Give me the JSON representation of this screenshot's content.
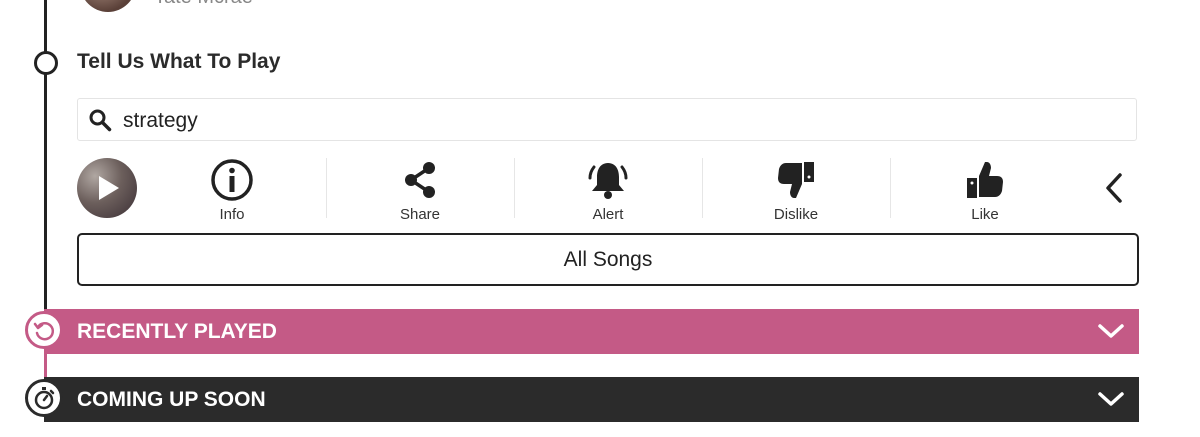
{
  "previous_item": {
    "title": "Tate Mcrae"
  },
  "section": {
    "title": "Tell Us What To Play"
  },
  "search": {
    "value": "strategy",
    "icon": "search-icon"
  },
  "actions": [
    {
      "label": "Info",
      "icon": "info-icon"
    },
    {
      "label": "Share",
      "icon": "share-icon"
    },
    {
      "label": "Alert",
      "icon": "bell-icon"
    },
    {
      "label": "Dislike",
      "icon": "thumbs-down-icon"
    },
    {
      "label": "Like",
      "icon": "thumbs-up-icon"
    }
  ],
  "all_songs": {
    "label": "All Songs"
  },
  "recently_played": {
    "label": "RECENTLY PLAYED",
    "color": "#c45a86"
  },
  "coming_up": {
    "label": "COMING UP SOON",
    "color": "#2b2b2b"
  }
}
